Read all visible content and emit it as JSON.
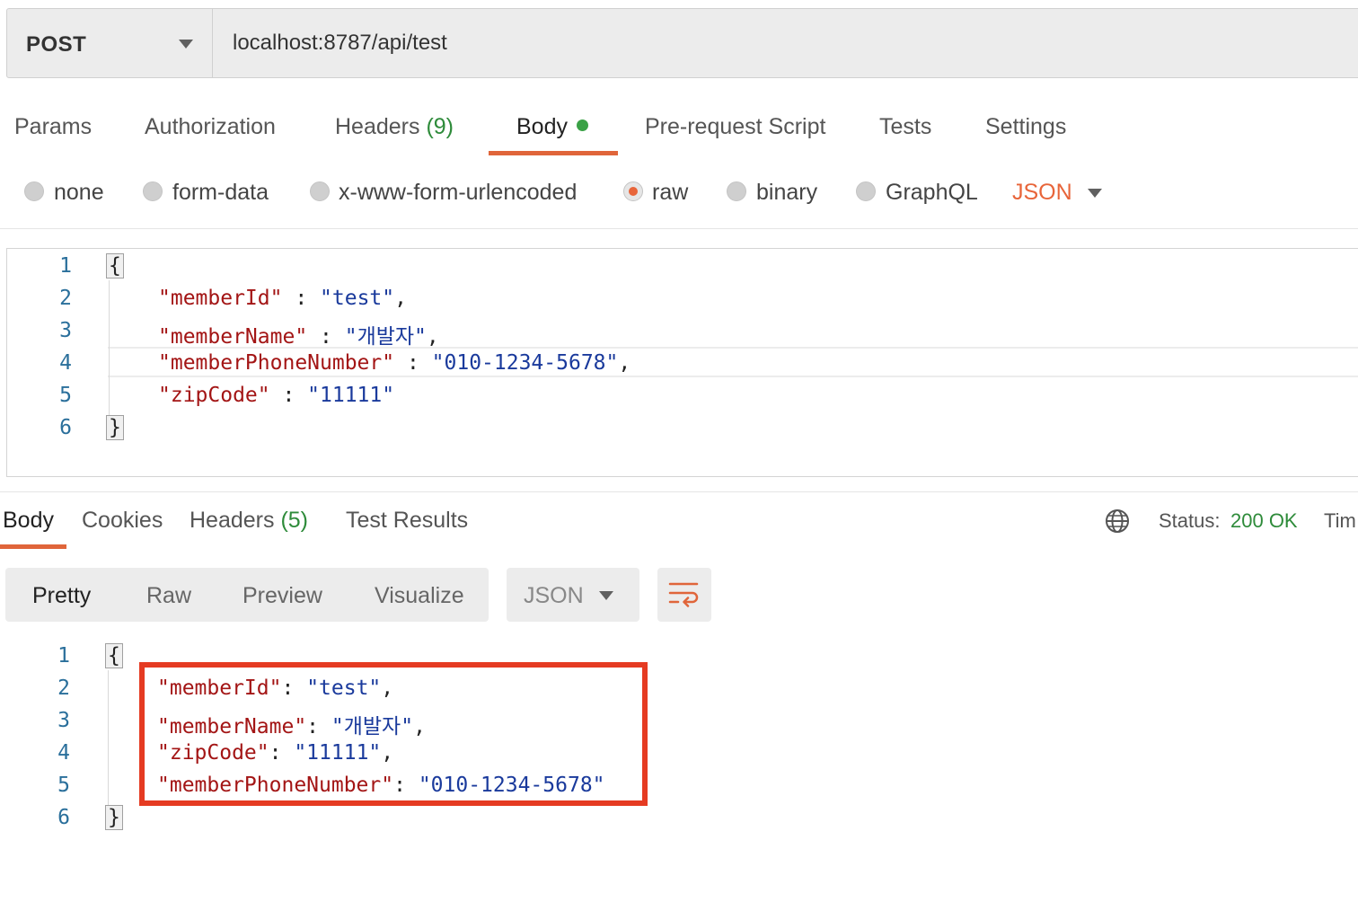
{
  "request": {
    "method": "POST",
    "url": "localhost:8787/api/test"
  },
  "request_tabs": {
    "params": "Params",
    "authorization": "Authorization",
    "headers": "Headers",
    "headers_count": "(9)",
    "body": "Body",
    "pre_request_script": "Pre-request Script",
    "tests": "Tests",
    "settings": "Settings",
    "active": "Body"
  },
  "body_types": {
    "options": [
      "none",
      "form-data",
      "x-www-form-urlencoded",
      "raw",
      "binary",
      "GraphQL"
    ],
    "selected": "raw",
    "format": "JSON"
  },
  "request_body": {
    "line_numbers": [
      "1",
      "2",
      "3",
      "4",
      "5",
      "6"
    ],
    "open_brace": "{",
    "close_brace": "}",
    "fields": [
      {
        "key": "\"memberId\"",
        "sep": " : ",
        "value": "\"test\"",
        "trail": ","
      },
      {
        "key": "\"memberName\"",
        "sep": " : ",
        "value": "\"개발자\"",
        "trail": ","
      },
      {
        "key": "\"memberPhoneNumber\"",
        "sep": " : ",
        "value": "\"010-1234-5678\"",
        "trail": ","
      },
      {
        "key": "\"zipCode\"",
        "sep": " : ",
        "value": "\"11111\"",
        "trail": ""
      }
    ]
  },
  "response_tabs": {
    "body": "Body",
    "cookies": "Cookies",
    "headers": "Headers",
    "headers_count": "(5)",
    "test_results": "Test Results",
    "active": "Body"
  },
  "response_status": {
    "label": "Status:",
    "value": "200 OK",
    "time_label": "Tim"
  },
  "response_view": {
    "modes": [
      "Pretty",
      "Raw",
      "Preview",
      "Visualize"
    ],
    "active": "Pretty",
    "format": "JSON"
  },
  "response_body": {
    "line_numbers": [
      "1",
      "2",
      "3",
      "4",
      "5",
      "6"
    ],
    "open_brace": "{",
    "close_brace": "}",
    "fields": [
      {
        "key": "\"memberId\"",
        "sep": ": ",
        "value": "\"test\"",
        "trail": ","
      },
      {
        "key": "\"memberName\"",
        "sep": ": ",
        "value": "\"개발자\"",
        "trail": ","
      },
      {
        "key": "\"zipCode\"",
        "sep": ": ",
        "value": "\"11111\"",
        "trail": ","
      },
      {
        "key": "\"memberPhoneNumber\"",
        "sep": ": ",
        "value": "\"010-1234-5678\"",
        "trail": ""
      }
    ]
  },
  "colors": {
    "accent": "#e0653a",
    "success": "#2e8b3a",
    "json_key": "#a31515",
    "json_string": "#1a3a9c",
    "highlight_box": "#e53b22"
  },
  "icons": {
    "method_dropdown": "chevron-down-icon",
    "format_dropdown": "chevron-down-icon",
    "globe": "globe-icon",
    "wrap": "wrap-lines-icon"
  }
}
